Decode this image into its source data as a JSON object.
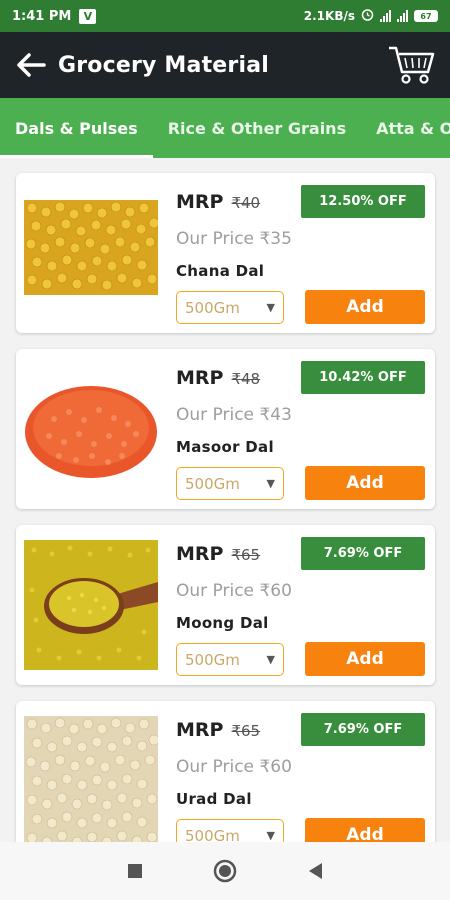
{
  "status_bar": {
    "time": "1:41 PM",
    "app_badge": "V",
    "speed": "2.1KB/s",
    "battery": "67"
  },
  "app_bar": {
    "title": "Grocery Material"
  },
  "tabs": [
    {
      "label": "Dals & Pulses",
      "active": true
    },
    {
      "label": "Rice & Other Grains",
      "active": false
    },
    {
      "label": "Atta & O",
      "active": false
    }
  ],
  "products": [
    {
      "mrp_label": "MRP",
      "mrp": "₹40",
      "discount": "12.50% OFF",
      "price_label": "Our Price",
      "price": "₹35",
      "name": "Chana Dal",
      "qty": "500Gm",
      "add_label": "Add",
      "image": "chana-dal-image"
    },
    {
      "mrp_label": "MRP",
      "mrp": "₹48",
      "discount": "10.42% OFF",
      "price_label": "Our Price",
      "price": "₹43",
      "name": "Masoor Dal",
      "qty": "500Gm",
      "add_label": "Add",
      "image": "masoor-dal-image"
    },
    {
      "mrp_label": "MRP",
      "mrp": "₹65",
      "discount": "7.69% OFF",
      "price_label": "Our Price",
      "price": "₹60",
      "name": "Moong Dal",
      "qty": "500Gm",
      "add_label": "Add",
      "image": "moong-dal-image"
    },
    {
      "mrp_label": "MRP",
      "mrp": "₹65",
      "discount": "7.69% OFF",
      "price_label": "Our Price",
      "price": "₹60",
      "name": "Urad Dal",
      "qty": "500Gm",
      "add_label": "Add",
      "image": "urad-dal-image"
    }
  ],
  "colors": {
    "header": "#1f2428",
    "tabs": "#4caf50",
    "discount": "#388e3c",
    "add": "#f7820d",
    "select_border": "#f5a623"
  },
  "icons": {
    "back": "arrow-left-icon",
    "cart": "shopping-cart-icon",
    "nav_recent": "square-icon",
    "nav_home": "circle-icon",
    "nav_back": "triangle-back-icon"
  }
}
